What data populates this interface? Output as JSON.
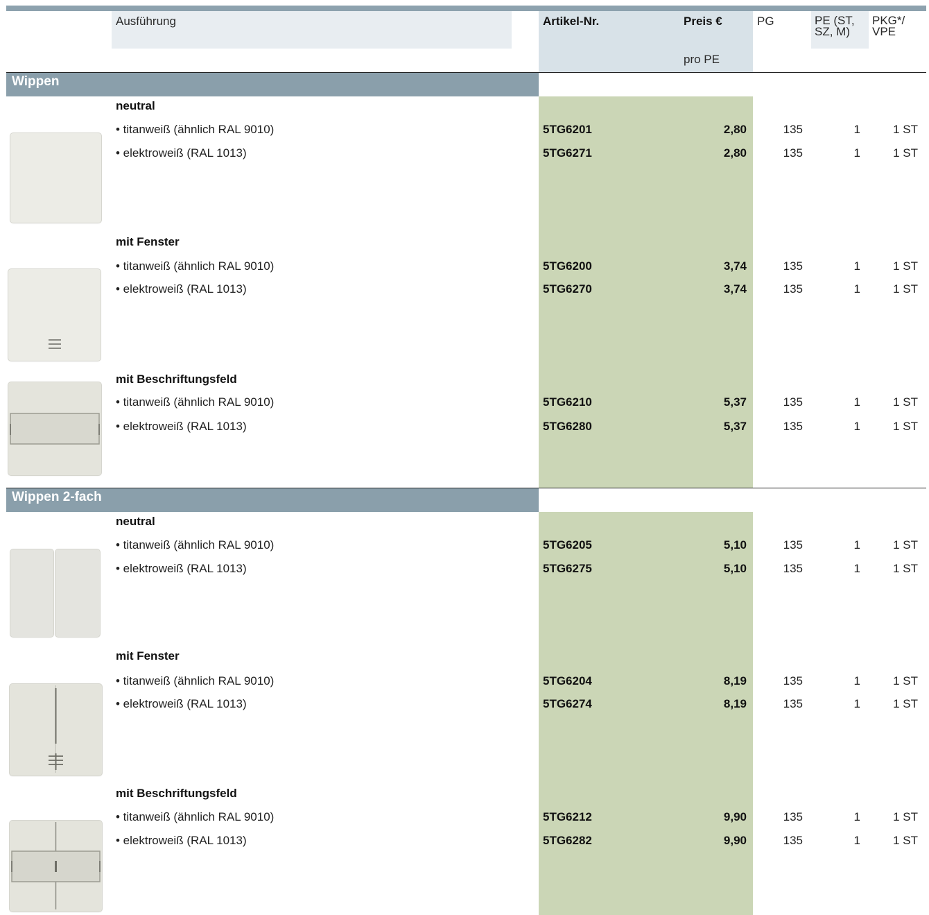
{
  "header": {
    "ausfuehrung": "Ausführung",
    "artikel_nr": "Artikel-Nr.",
    "preis": "Preis €",
    "pro_pe": "pro PE",
    "pg": "PG",
    "pe_line1": "PE (ST,",
    "pe_line2": "SZ, M)",
    "pkg_line1": "PKG*/",
    "pkg_line2": "VPE"
  },
  "sections": [
    {
      "title": "Wippen",
      "groups": [
        {
          "name": "neutral",
          "rows": [
            {
              "desc": "• titanweiß (ähnlich RAL 9010)",
              "art": "5TG6201",
              "price": "2,80",
              "pg": "135",
              "pe": "1",
              "pkg": "1 ST"
            },
            {
              "desc": "• elektroweiß (RAL 1013)",
              "art": "5TG6271",
              "price": "2,80",
              "pg": "135",
              "pe": "1",
              "pkg": "1 ST"
            }
          ]
        },
        {
          "name": "mit Fenster",
          "rows": [
            {
              "desc": "• titanweiß (ähnlich RAL 9010)",
              "art": "5TG6200",
              "price": "3,74",
              "pg": "135",
              "pe": "1",
              "pkg": "1 ST"
            },
            {
              "desc": "• elektroweiß (RAL 1013)",
              "art": "5TG6270",
              "price": "3,74",
              "pg": "135",
              "pe": "1",
              "pkg": "1 ST"
            }
          ]
        },
        {
          "name": "mit Beschriftungsfeld",
          "rows": [
            {
              "desc": "• titanweiß (ähnlich RAL 9010)",
              "art": "5TG6210",
              "price": "5,37",
              "pg": "135",
              "pe": "1",
              "pkg": "1 ST"
            },
            {
              "desc": "• elektroweiß (RAL 1013)",
              "art": "5TG6280",
              "price": "5,37",
              "pg": "135",
              "pe": "1",
              "pkg": "1 ST"
            }
          ]
        }
      ]
    },
    {
      "title": "Wippen 2-fach",
      "groups": [
        {
          "name": "neutral",
          "rows": [
            {
              "desc": "• titanweiß (ähnlich RAL 9010)",
              "art": "5TG6205",
              "price": "5,10",
              "pg": "135",
              "pe": "1",
              "pkg": "1 ST"
            },
            {
              "desc": "• elektroweiß (RAL 1013)",
              "art": "5TG6275",
              "price": "5,10",
              "pg": "135",
              "pe": "1",
              "pkg": "1 ST"
            }
          ]
        },
        {
          "name": "mit Fenster",
          "rows": [
            {
              "desc": "• titanweiß (ähnlich RAL 9010)",
              "art": "5TG6204",
              "price": "8,19",
              "pg": "135",
              "pe": "1",
              "pkg": "1 ST"
            },
            {
              "desc": "• elektroweiß (RAL 1013)",
              "art": "5TG6274",
              "price": "8,19",
              "pg": "135",
              "pe": "1",
              "pkg": "1 ST"
            }
          ]
        },
        {
          "name": "mit Beschriftungsfeld",
          "rows": [
            {
              "desc": "• titanweiß (ähnlich RAL 9010)",
              "art": "5TG6212",
              "price": "9,90",
              "pg": "135",
              "pe": "1",
              "pkg": "1 ST"
            },
            {
              "desc": "• elektroweiß (RAL 1013)",
              "art": "5TG6282",
              "price": "9,90",
              "pg": "135",
              "pe": "1",
              "pkg": "1 ST"
            }
          ]
        }
      ]
    }
  ],
  "colors": {
    "section_bar": "#8a9fab",
    "price_column": "#cbd6b6",
    "header_shade": "#d8e2e8"
  },
  "icons": [
    "rocker-neutral-icon",
    "rocker-window-icon",
    "rocker-label-field-icon",
    "double-rocker-neutral-icon",
    "double-rocker-window-icon",
    "double-rocker-label-field-icon"
  ]
}
